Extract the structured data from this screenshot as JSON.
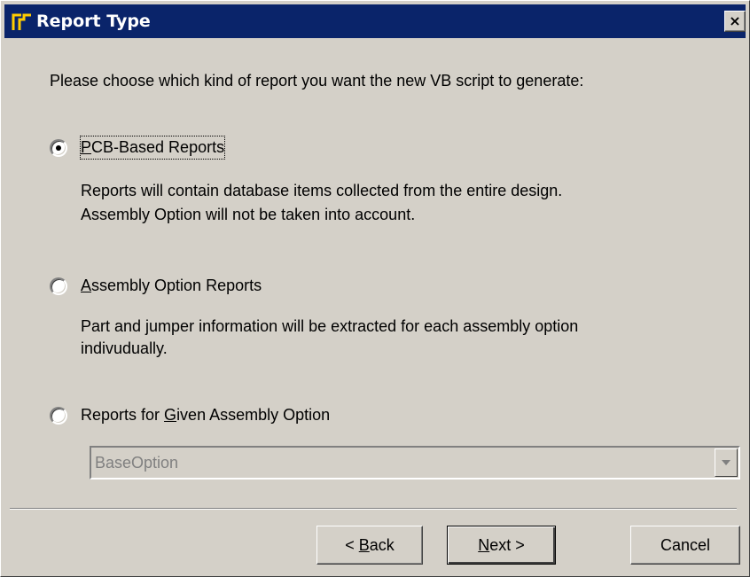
{
  "window": {
    "title": "Report Type",
    "close_label": "×"
  },
  "prompt": "Please choose which kind of report you want the new VB script to generate:",
  "options": [
    {
      "label_pre": "",
      "label_key": "P",
      "label_post": "CB-Based Reports",
      "selected": true,
      "description_lines": [
        "Reports will contain database items collected from the entire design.",
        "Assembly Option will not be taken into account."
      ]
    },
    {
      "label_pre": "",
      "label_key": "A",
      "label_post": "ssembly Option Reports",
      "selected": false,
      "description_lines": [
        "Part and jumper information will be extracted for each assembly option",
        "indivudually."
      ]
    },
    {
      "label_pre": "Reports for ",
      "label_key": "G",
      "label_post": "iven Assembly Option",
      "selected": false,
      "description_lines": []
    }
  ],
  "assembly_option_select": {
    "value": "BaseOption",
    "disabled": true
  },
  "buttons": {
    "back": {
      "pre": "< ",
      "key": "B",
      "post": "ack"
    },
    "next": {
      "pre": "",
      "key": "N",
      "post": "ext >"
    },
    "cancel": "Cancel"
  },
  "colors": {
    "dialog_background": "#d4d0c8",
    "title_bar": "#0a246a",
    "disabled_text": "#808080"
  }
}
